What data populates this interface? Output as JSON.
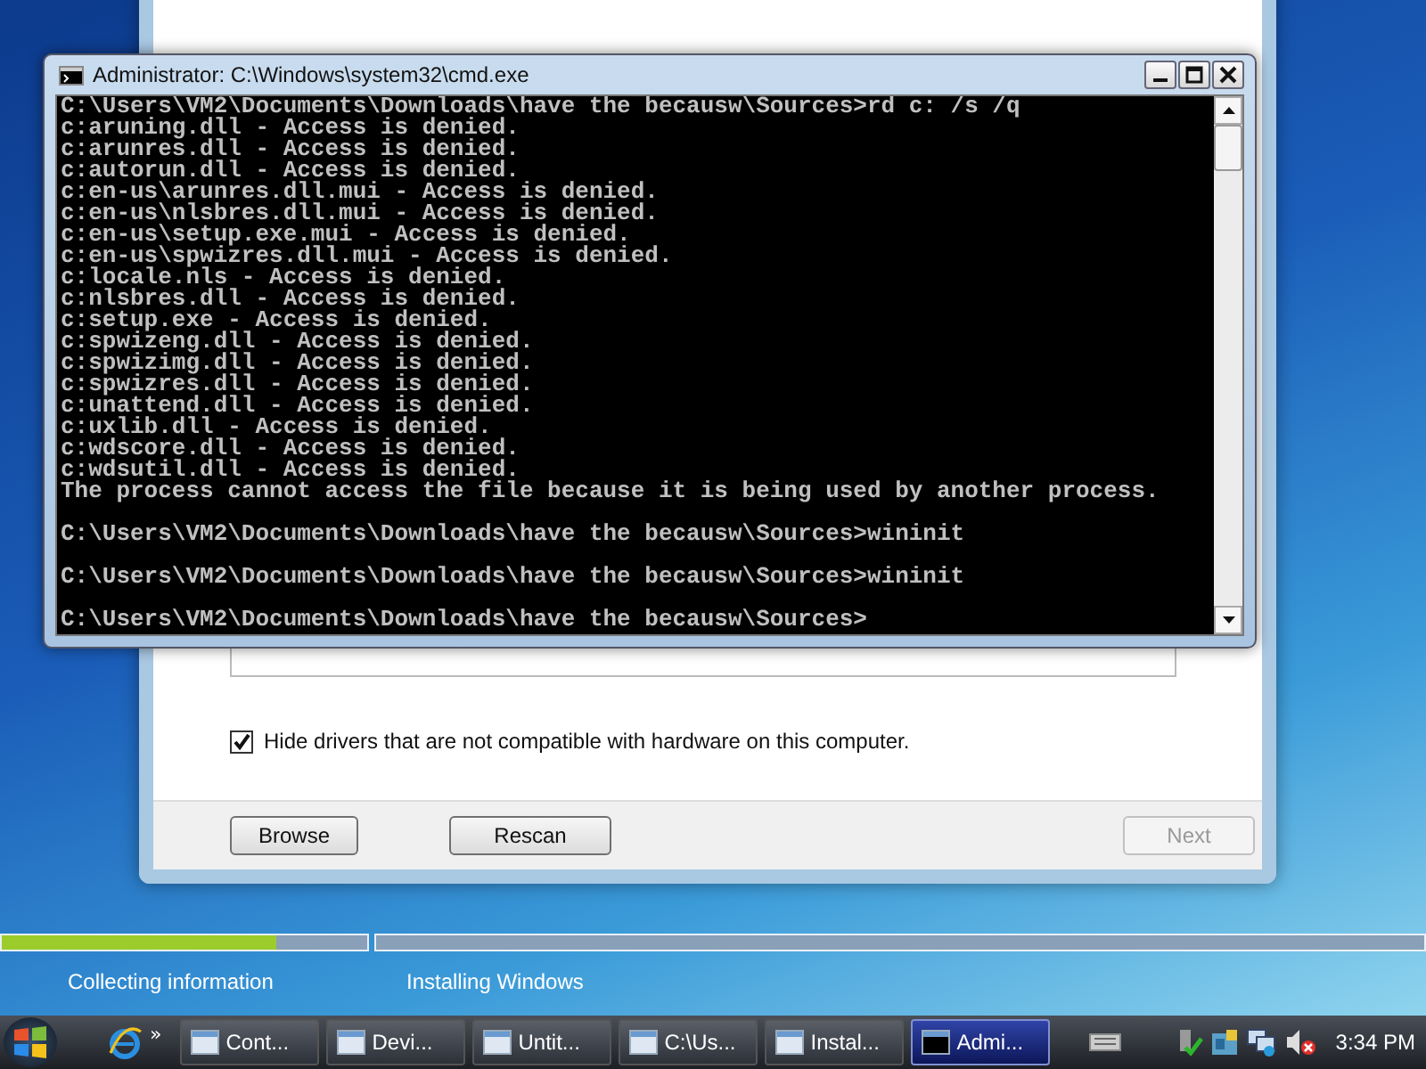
{
  "installer": {
    "checkbox": {
      "label": "Hide drivers that are not compatible with hardware on this computer.",
      "checked": true
    },
    "buttons": [
      {
        "label": "Browse",
        "disabled": false
      },
      {
        "label": "Rescan",
        "disabled": false
      },
      {
        "label": "Next",
        "disabled": true
      }
    ]
  },
  "console": {
    "title": "Administrator: C:\\Windows\\system32\\cmd.exe",
    "lines": [
      "C:\\Users\\VM2\\Documents\\Downloads\\have the becausw\\Sources>rd c: /s /q",
      "c:aruning.dll - Access is denied.",
      "c:arunres.dll - Access is denied.",
      "c:autorun.dll - Access is denied.",
      "c:en-us\\arunres.dll.mui - Access is denied.",
      "c:en-us\\nlsbres.dll.mui - Access is denied.",
      "c:en-us\\setup.exe.mui - Access is denied.",
      "c:en-us\\spwizres.dll.mui - Access is denied.",
      "c:locale.nls - Access is denied.",
      "c:nlsbres.dll - Access is denied.",
      "c:setup.exe - Access is denied.",
      "c:spwizeng.dll - Access is denied.",
      "c:spwizimg.dll - Access is denied.",
      "c:spwizres.dll - Access is denied.",
      "c:unattend.dll - Access is denied.",
      "c:uxlib.dll - Access is denied.",
      "c:wdscore.dll - Access is denied.",
      "c:wdsutil.dll - Access is denied.",
      "The process cannot access the file because it is being used by another process.",
      {
        "kind": "blank"
      },
      "C:\\Users\\VM2\\Documents\\Downloads\\have the becausw\\Sources>wininit",
      {
        "kind": "blank"
      },
      "C:\\Users\\VM2\\Documents\\Downloads\\have the becausw\\Sources>wininit",
      {
        "kind": "blank"
      },
      "C:\\Users\\VM2\\Documents\\Downloads\\have the becausw\\Sources>"
    ]
  },
  "progress": [
    {
      "label": "Collecting information",
      "level": 0.75
    },
    {
      "label": "Installing Windows"
    }
  ],
  "taskbar": {
    "more": "»",
    "tasks": [
      {
        "label": "Cont...",
        "selected": false
      },
      {
        "label": "Devi...",
        "selected": false
      },
      {
        "label": "Untit...",
        "selected": false
      },
      {
        "label": "C:\\Us...",
        "selected": false
      },
      {
        "label": "Instal...",
        "selected": false
      },
      {
        "label": "Admi...",
        "selected": true
      }
    ],
    "clock": "3:34 PM"
  }
}
